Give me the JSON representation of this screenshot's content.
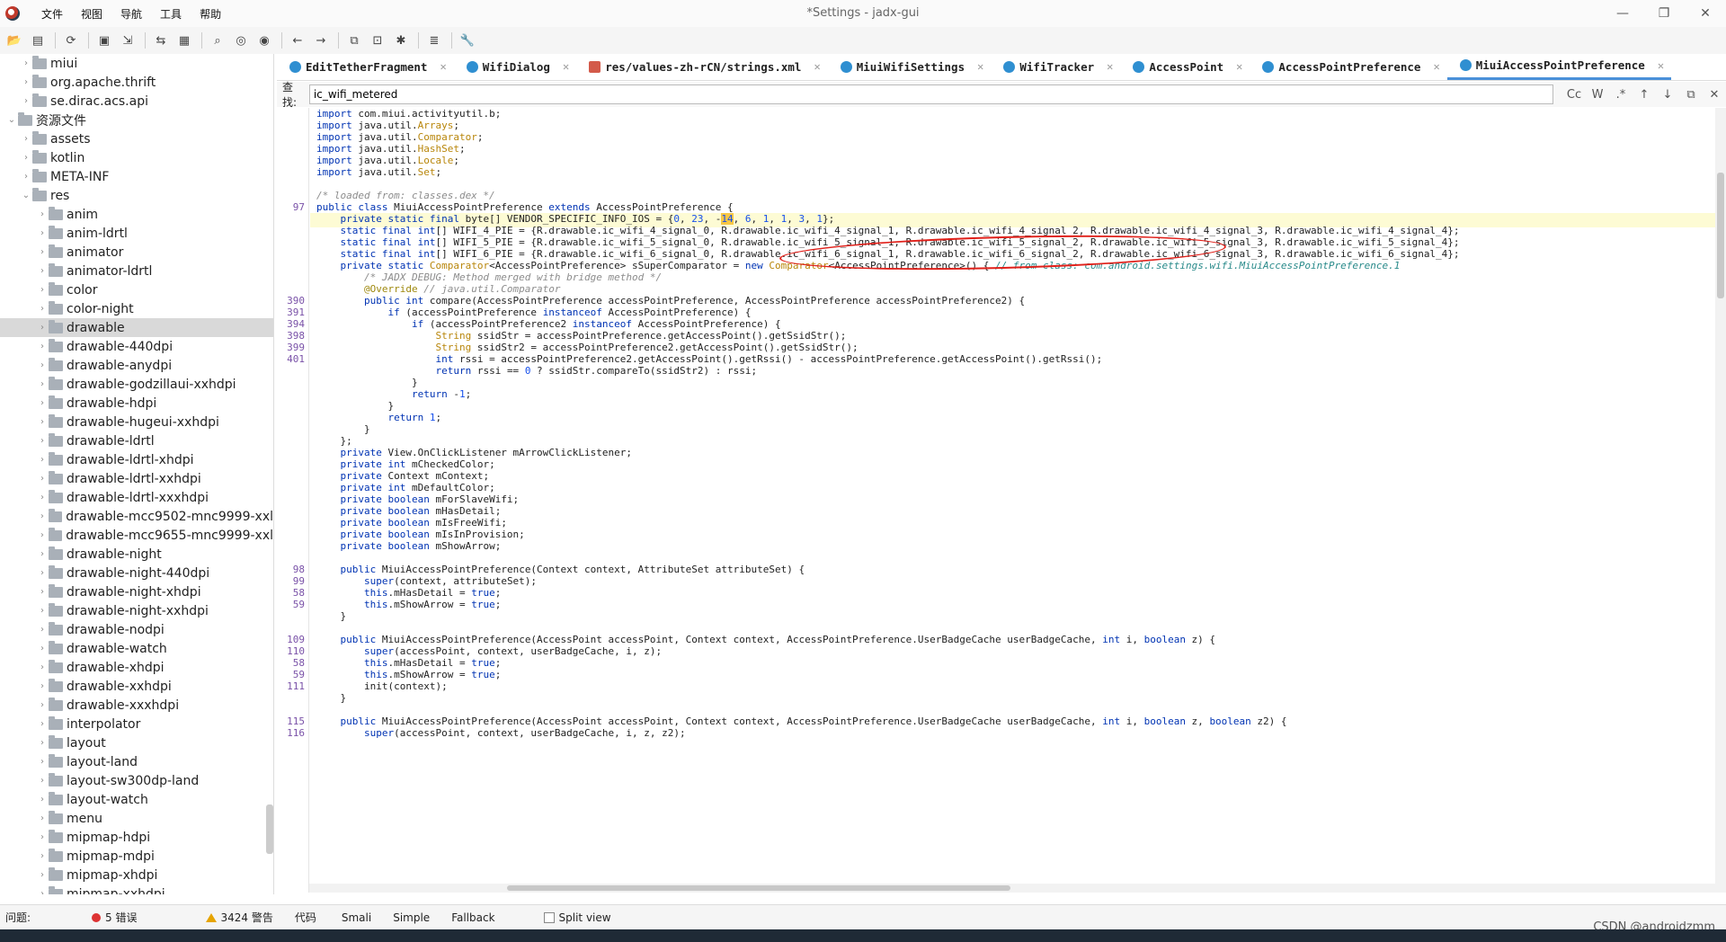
{
  "window": {
    "title": "*Settings - jadx-gui"
  },
  "menu": [
    "文件",
    "视图",
    "导航",
    "工具",
    "帮助"
  ],
  "tree": [
    {
      "label": "miui",
      "arrow": "›",
      "indent": 0
    },
    {
      "label": "org.apache.thrift",
      "arrow": "›",
      "indent": 0
    },
    {
      "label": "se.dirac.acs.api",
      "arrow": "›",
      "indent": 0
    },
    {
      "label": "资源文件",
      "arrow": "⌄",
      "indent": -1
    },
    {
      "label": "assets",
      "arrow": "›",
      "indent": 0
    },
    {
      "label": "kotlin",
      "arrow": "›",
      "indent": 0
    },
    {
      "label": "META-INF",
      "arrow": "›",
      "indent": 0
    },
    {
      "label": "res",
      "arrow": "⌄",
      "indent": 0
    },
    {
      "label": "anim",
      "arrow": "›",
      "indent": 1
    },
    {
      "label": "anim-ldrtl",
      "arrow": "›",
      "indent": 1
    },
    {
      "label": "animator",
      "arrow": "›",
      "indent": 1
    },
    {
      "label": "animator-ldrtl",
      "arrow": "›",
      "indent": 1
    },
    {
      "label": "color",
      "arrow": "›",
      "indent": 1
    },
    {
      "label": "color-night",
      "arrow": "›",
      "indent": 1
    },
    {
      "label": "drawable",
      "arrow": "›",
      "indent": 1,
      "selected": true
    },
    {
      "label": "drawable-440dpi",
      "arrow": "›",
      "indent": 1
    },
    {
      "label": "drawable-anydpi",
      "arrow": "›",
      "indent": 1
    },
    {
      "label": "drawable-godzillaui-xxhdpi",
      "arrow": "›",
      "indent": 1
    },
    {
      "label": "drawable-hdpi",
      "arrow": "›",
      "indent": 1
    },
    {
      "label": "drawable-hugeui-xxhdpi",
      "arrow": "›",
      "indent": 1
    },
    {
      "label": "drawable-ldrtl",
      "arrow": "›",
      "indent": 1
    },
    {
      "label": "drawable-ldrtl-xhdpi",
      "arrow": "›",
      "indent": 1
    },
    {
      "label": "drawable-ldrtl-xxhdpi",
      "arrow": "›",
      "indent": 1
    },
    {
      "label": "drawable-ldrtl-xxxhdpi",
      "arrow": "›",
      "indent": 1
    },
    {
      "label": "drawable-mcc9502-mnc9999-xxl",
      "arrow": "›",
      "indent": 1
    },
    {
      "label": "drawable-mcc9655-mnc9999-xxl",
      "arrow": "›",
      "indent": 1
    },
    {
      "label": "drawable-night",
      "arrow": "›",
      "indent": 1
    },
    {
      "label": "drawable-night-440dpi",
      "arrow": "›",
      "indent": 1
    },
    {
      "label": "drawable-night-xhdpi",
      "arrow": "›",
      "indent": 1
    },
    {
      "label": "drawable-night-xxhdpi",
      "arrow": "›",
      "indent": 1
    },
    {
      "label": "drawable-nodpi",
      "arrow": "›",
      "indent": 1
    },
    {
      "label": "drawable-watch",
      "arrow": "›",
      "indent": 1
    },
    {
      "label": "drawable-xhdpi",
      "arrow": "›",
      "indent": 1
    },
    {
      "label": "drawable-xxhdpi",
      "arrow": "›",
      "indent": 1
    },
    {
      "label": "drawable-xxxhdpi",
      "arrow": "›",
      "indent": 1
    },
    {
      "label": "interpolator",
      "arrow": "›",
      "indent": 1
    },
    {
      "label": "layout",
      "arrow": "›",
      "indent": 1
    },
    {
      "label": "layout-land",
      "arrow": "›",
      "indent": 1
    },
    {
      "label": "layout-sw300dp-land",
      "arrow": "›",
      "indent": 1
    },
    {
      "label": "layout-watch",
      "arrow": "›",
      "indent": 1
    },
    {
      "label": "menu",
      "arrow": "›",
      "indent": 1
    },
    {
      "label": "mipmap-hdpi",
      "arrow": "›",
      "indent": 1
    },
    {
      "label": "mipmap-mdpi",
      "arrow": "›",
      "indent": 1
    },
    {
      "label": "mipmap-xhdpi",
      "arrow": "›",
      "indent": 1
    },
    {
      "label": "mipmap-xxhdpi",
      "arrow": "›",
      "indent": 1
    }
  ],
  "tabs": [
    {
      "label": "EditTetherFragment",
      "icon": "class-icon"
    },
    {
      "label": "WifiDialog",
      "icon": "class-icon"
    },
    {
      "label": "res/values-zh-rCN/strings.xml",
      "icon": "xml-file-icon"
    },
    {
      "label": "MiuiWifiSettings",
      "icon": "class-icon"
    },
    {
      "label": "WifiTracker",
      "icon": "class-icon"
    },
    {
      "label": "AccessPoint",
      "icon": "class-icon"
    },
    {
      "label": "AccessPointPreference",
      "icon": "class-icon"
    },
    {
      "label": "MiuiAccessPointPreference",
      "icon": "class-icon",
      "active": true
    }
  ],
  "find": {
    "label": "查找:",
    "value": "ic_wifi_metered",
    "options": [
      "Cc",
      "W",
      ".*",
      "↑",
      "↓",
      "⧉",
      "✕"
    ]
  },
  "code": [
    {
      "ln": "",
      "html": "<span class='kw'>import</span> com.miui.activityutil.b;"
    },
    {
      "ln": "",
      "html": "<span class='kw'>import</span> java.util.<span class='cls'>Arrays</span>;"
    },
    {
      "ln": "",
      "html": "<span class='kw'>import</span> java.util.<span class='cls'>Comparator</span>;"
    },
    {
      "ln": "",
      "html": "<span class='kw'>import</span> java.util.<span class='cls'>HashSet</span>;"
    },
    {
      "ln": "",
      "html": "<span class='kw'>import</span> java.util.<span class='cls'>Locale</span>;"
    },
    {
      "ln": "",
      "html": "<span class='kw'>import</span> java.util.<span class='cls'>Set</span>;"
    },
    {
      "ln": "",
      "html": ""
    },
    {
      "ln": "",
      "html": "<span class='cm'>/* loaded from: classes.dex */</span>"
    },
    {
      "ln": "97",
      "html": "<span class='kw'>public class</span> MiuiAccessPointPreference <span class='kw'>extends</span> AccessPointPreference {"
    },
    {
      "ln": "",
      "hl": true,
      "html": "    <span class='kw'>private static final</span> byte[] VENDOR_SPECIFIC_INFO_IOS = {<span class='num'>0</span>, <span class='num'>23</span>, -<span class='mk num'>14</span>, <span class='num'>6</span>, <span class='num'>1</span>, <span class='num'>1</span>, <span class='num'>3</span>, <span class='num'>1</span>};"
    },
    {
      "ln": "",
      "html": "    <span class='kw'>static final int</span>[] WIFI_4_PIE = {R.drawable.ic_wifi_4_signal_0, R.drawable.ic_wifi_4_signal_1, R.drawable.ic_wifi_4_signal_2, R.drawable.ic_wifi_4_signal_3, R.drawable.ic_wifi_4_signal_4};"
    },
    {
      "ln": "",
      "html": "    <span class='kw'>static final int</span>[] WIFI_5_PIE = {R.drawable.ic_wifi_5_signal_0, R.drawable.ic_wifi_5_signal_1, R.drawable.ic_wifi_5_signal_2, R.drawable.ic_wifi_5_signal_3, R.drawable.ic_wifi_5_signal_4};"
    },
    {
      "ln": "",
      "html": "    <span class='kw'>static final int</span>[] WIFI_6_PIE = {R.drawable.ic_wifi_6_signal_0, R.drawable.ic_wifi_6_signal_1, R.drawable.ic_wifi_6_signal_2, R.drawable.ic_wifi_6_signal_3, R.drawable.ic_wifi_6_signal_4};"
    },
    {
      "ln": "",
      "html": "    <span class='kw'>private static</span> <span class='cls'>Comparator</span>&lt;AccessPointPreference&gt; sSuperComparator = <span class='kw'>new</span> <span class='cls'>Comparator</span>&lt;AccessPointPreference&gt;() { <span class='cm2'>// from class: com.android.settings.wifi.MiuiAccessPointPreference.1</span>"
    },
    {
      "ln": "",
      "html": "        <span class='cm'>/* JADX DEBUG: Method merged with bridge method */</span>"
    },
    {
      "ln": "",
      "html": "        <span class='an'>@Override</span> <span class='cm'>// java.util.Comparator</span>"
    },
    {
      "ln": "390",
      "html": "        <span class='kw'>public int</span> compare(AccessPointPreference accessPointPreference, AccessPointPreference accessPointPreference2) {"
    },
    {
      "ln": "391",
      "html": "            <span class='kw'>if</span> (accessPointPreference <span class='kw'>instanceof</span> AccessPointPreference) {"
    },
    {
      "ln": "394",
      "html": "                <span class='kw'>if</span> (accessPointPreference2 <span class='kw'>instanceof</span> AccessPointPreference) {"
    },
    {
      "ln": "398",
      "html": "                    <span class='cls'>String</span> ssidStr = accessPointPreference.getAccessPoint().getSsidStr();"
    },
    {
      "ln": "399",
      "html": "                    <span class='cls'>String</span> ssidStr2 = accessPointPreference2.getAccessPoint().getSsidStr();"
    },
    {
      "ln": "401",
      "html": "                    <span class='kw'>int</span> rssi = accessPointPreference2.getAccessPoint().getRssi() - accessPointPreference.getAccessPoint().getRssi();"
    },
    {
      "ln": "",
      "html": "                    <span class='kw'>return</span> rssi == <span class='num'>0</span> ? ssidStr.compareTo(ssidStr2) : rssi;"
    },
    {
      "ln": "",
      "html": "                }"
    },
    {
      "ln": "",
      "html": "                <span class='kw'>return</span> -<span class='num'>1</span>;"
    },
    {
      "ln": "",
      "html": "            }"
    },
    {
      "ln": "",
      "html": "            <span class='kw'>return</span> <span class='num'>1</span>;"
    },
    {
      "ln": "",
      "html": "        }"
    },
    {
      "ln": "",
      "html": "    };"
    },
    {
      "ln": "",
      "html": "    <span class='kw'>private</span> View.OnClickListener mArrowClickListener;"
    },
    {
      "ln": "",
      "html": "    <span class='kw'>private int</span> mCheckedColor;"
    },
    {
      "ln": "",
      "html": "    <span class='kw'>private</span> Context mContext;"
    },
    {
      "ln": "",
      "html": "    <span class='kw'>private int</span> mDefaultColor;"
    },
    {
      "ln": "",
      "html": "    <span class='kw'>private boolean</span> mForSlaveWifi;"
    },
    {
      "ln": "",
      "html": "    <span class='kw'>private boolean</span> mHasDetail;"
    },
    {
      "ln": "",
      "html": "    <span class='kw'>private boolean</span> mIsFreeWifi;"
    },
    {
      "ln": "",
      "html": "    <span class='kw'>private boolean</span> mIsInProvision;"
    },
    {
      "ln": "",
      "html": "    <span class='kw'>private boolean</span> mShowArrow;"
    },
    {
      "ln": "",
      "html": ""
    },
    {
      "ln": "98",
      "html": "    <span class='kw'>public</span> MiuiAccessPointPreference(Context context, AttributeSet attributeSet) {"
    },
    {
      "ln": "99",
      "html": "        <span class='kw'>super</span>(context, attributeSet);"
    },
    {
      "ln": "58",
      "html": "        <span class='kw'>this</span>.mHasDetail = <span class='kw'>true</span>;"
    },
    {
      "ln": "59",
      "html": "        <span class='kw'>this</span>.mShowArrow = <span class='kw'>true</span>;"
    },
    {
      "ln": "",
      "html": "    }"
    },
    {
      "ln": "",
      "html": ""
    },
    {
      "ln": "109",
      "html": "    <span class='kw'>public</span> MiuiAccessPointPreference(AccessPoint accessPoint, Context context, AccessPointPreference.UserBadgeCache userBadgeCache, <span class='kw'>int</span> i, <span class='kw'>boolean</span> z) {"
    },
    {
      "ln": "110",
      "html": "        <span class='kw'>super</span>(accessPoint, context, userBadgeCache, i, z);"
    },
    {
      "ln": "58",
      "html": "        <span class='kw'>this</span>.mHasDetail = <span class='kw'>true</span>;"
    },
    {
      "ln": "59",
      "html": "        <span class='kw'>this</span>.mShowArrow = <span class='kw'>true</span>;"
    },
    {
      "ln": "111",
      "html": "        init(context);"
    },
    {
      "ln": "",
      "html": "    }"
    },
    {
      "ln": "",
      "html": ""
    },
    {
      "ln": "115",
      "html": "    <span class='kw'>public</span> MiuiAccessPointPreference(AccessPoint accessPoint, Context context, AccessPointPreference.UserBadgeCache userBadgeCache, <span class='kw'>int</span> i, <span class='kw'>boolean</span> z, <span class='kw'>boolean</span> z2) {"
    },
    {
      "ln": "116",
      "html": "        <span class='kw'>super</span>(accessPoint, context, userBadgeCache, i, z, z2);"
    }
  ],
  "bottom": {
    "problems": "问题:",
    "errors": "5 错误",
    "warnings": "3424 警告",
    "views": [
      "代码",
      "Smali",
      "Simple",
      "Fallback"
    ],
    "split": "Split view"
  },
  "watermark": "CSDN @androidzmm"
}
